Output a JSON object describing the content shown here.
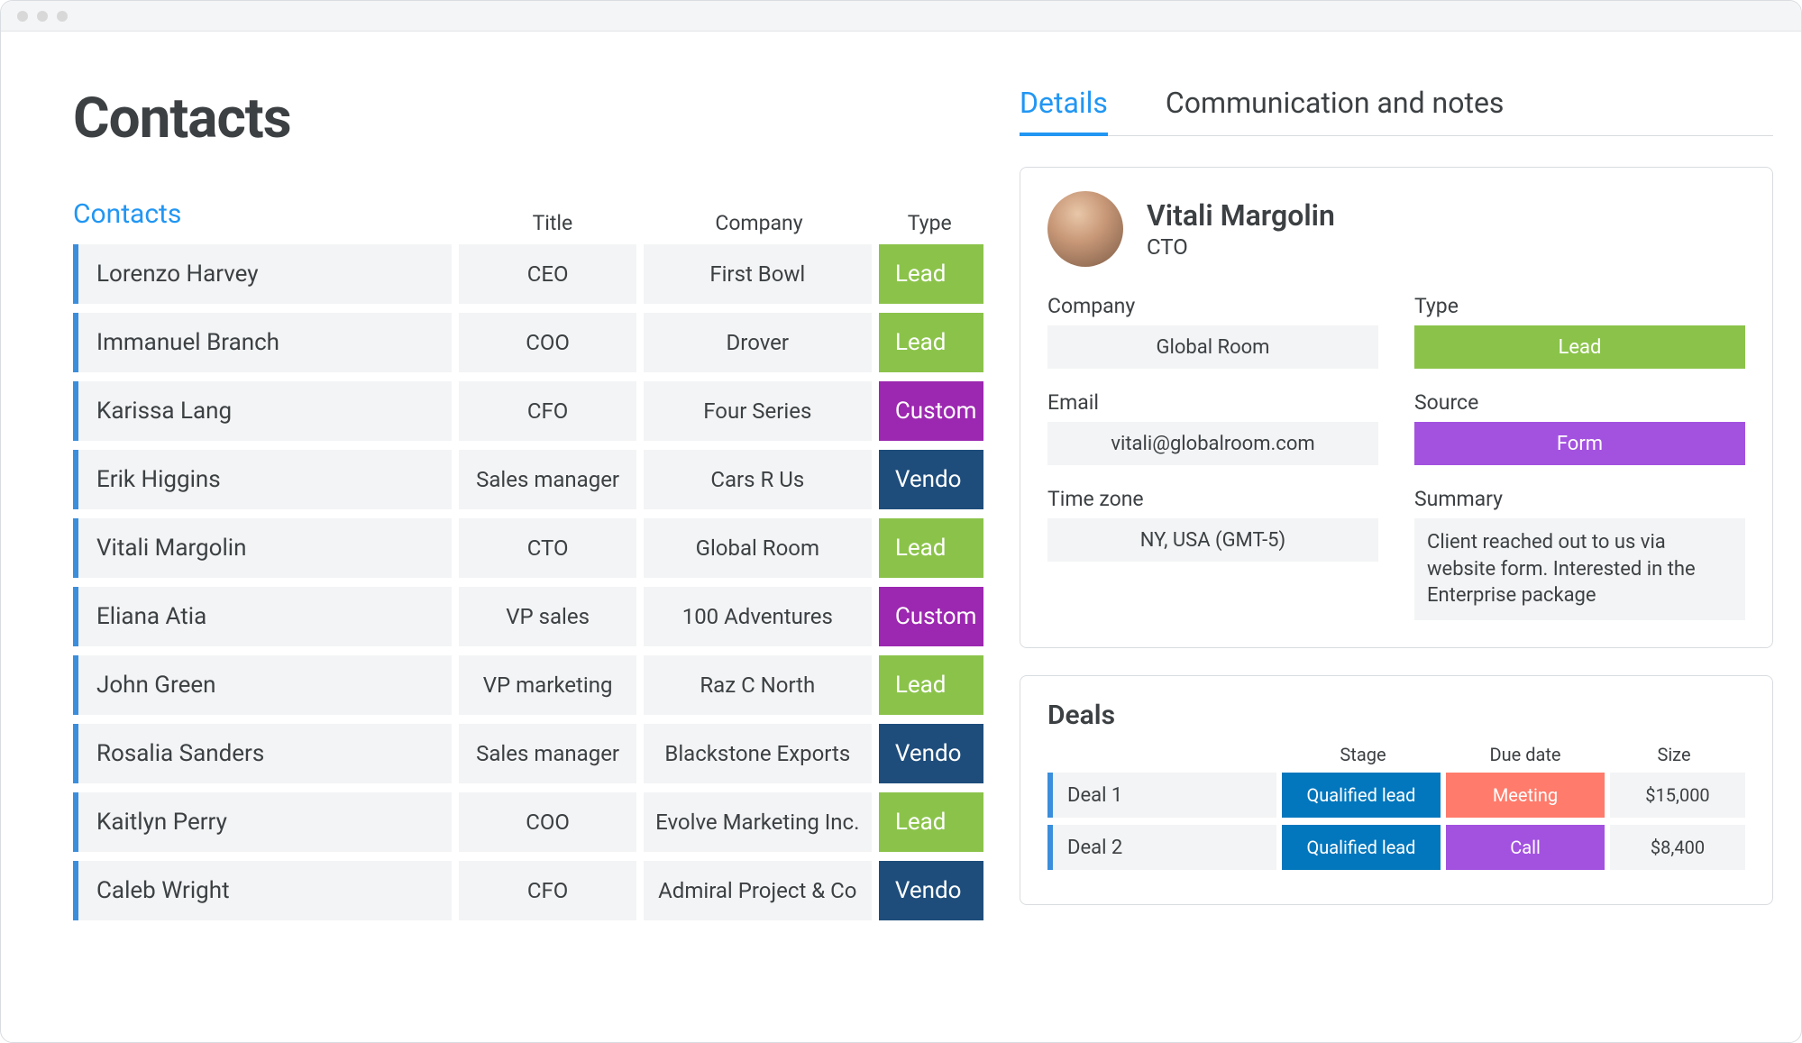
{
  "page": {
    "title": "Contacts"
  },
  "list": {
    "tab": "Contacts",
    "headers": {
      "title": "Title",
      "company": "Company",
      "type": "Type"
    },
    "rows": [
      {
        "name": "Lorenzo Harvey",
        "title": "CEO",
        "company": "First Bowl",
        "type": "Lead",
        "type_style": "lead"
      },
      {
        "name": "Immanuel Branch",
        "title": "COO",
        "company": "Drover",
        "type": "Lead",
        "type_style": "lead"
      },
      {
        "name": "Karissa Lang",
        "title": "CFO",
        "company": "Four Series",
        "type": "Custom",
        "type_style": "custom"
      },
      {
        "name": "Erik Higgins",
        "title": "Sales manager",
        "company": "Cars R Us",
        "type": "Vendo",
        "type_style": "vendo"
      },
      {
        "name": "Vitali Margolin",
        "title": "CTO",
        "company": "Global Room",
        "type": "Lead",
        "type_style": "lead"
      },
      {
        "name": "Eliana Atia",
        "title": "VP sales",
        "company": "100 Adventures",
        "type": "Custom",
        "type_style": "custom"
      },
      {
        "name": "John Green",
        "title": "VP marketing",
        "company": "Raz C North",
        "type": "Lead",
        "type_style": "lead"
      },
      {
        "name": "Rosalia Sanders",
        "title": "Sales manager",
        "company": "Blackstone Exports",
        "type": "Vendo",
        "type_style": "vendo"
      },
      {
        "name": "Kaitlyn Perry",
        "title": "COO",
        "company": "Evolve Marketing Inc.",
        "type": "Lead",
        "type_style": "lead"
      },
      {
        "name": "Caleb Wright",
        "title": "CFO",
        "company": "Admiral Project & Co",
        "type": "Vendo",
        "type_style": "vendo"
      }
    ]
  },
  "tabs": {
    "details": "Details",
    "comm": "Communication and notes"
  },
  "details": {
    "name": "Vitali Margolin",
    "title": "CTO",
    "labels": {
      "company": "Company",
      "type": "Type",
      "email": "Email",
      "source": "Source",
      "timezone": "Time zone",
      "summary": "Summary"
    },
    "values": {
      "company": "Global Room",
      "type": "Lead",
      "email": "vitali@globalroom.com",
      "source": "Form",
      "timezone": "NY, USA (GMT-5)",
      "summary": "Client reached out to us via website form. Interested in the Enterprise package"
    }
  },
  "deals": {
    "title": "Deals",
    "headers": {
      "stage": "Stage",
      "due": "Due date",
      "size": "Size"
    },
    "rows": [
      {
        "name": "Deal 1",
        "stage": "Qualified lead",
        "due": "Meeting",
        "due_style": "meeting",
        "size": "$15,000"
      },
      {
        "name": "Deal 2",
        "stage": "Qualified lead",
        "due": "Call",
        "due_style": "call",
        "size": "$8,400"
      }
    ]
  }
}
